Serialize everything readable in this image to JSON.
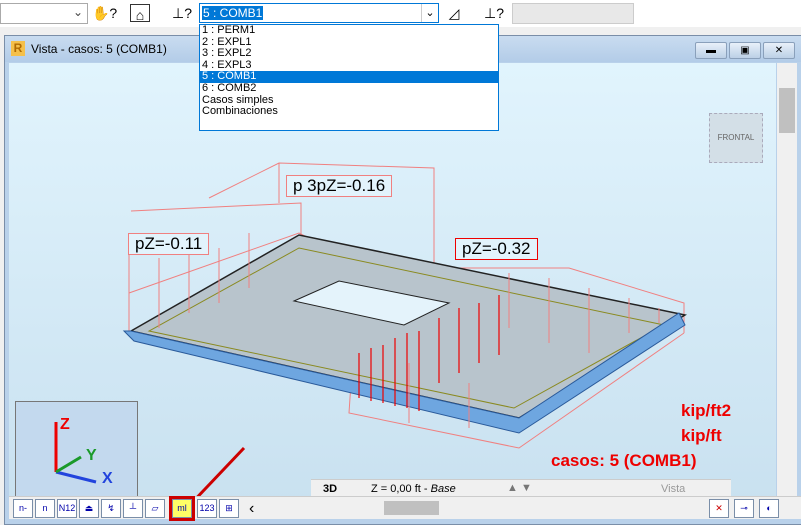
{
  "toolbar": {
    "selected_case": "5 : COMB1",
    "icons": [
      "hand-help-icon",
      "view-icon",
      "load-help-icon",
      "load-chart-icon",
      "load-help2-icon"
    ]
  },
  "case_list": [
    "1 : PERM1",
    "2 : EXPL1",
    "3 : EXPL2",
    "4 : EXPL3",
    "5 : COMB1",
    "6 : COMB2",
    "Casos simples",
    "Combinaciones"
  ],
  "window": {
    "title": "Vista - casos: 5 (COMB1)",
    "logo": "R",
    "view_cube": "FRONTAL"
  },
  "view": {
    "labels": [
      "p 3pZ=-0.16",
      "pZ=-0.11",
      "pZ=-0.32"
    ],
    "axes": {
      "z": "Z",
      "y": "Y",
      "x": "X"
    },
    "legend": {
      "area_unit": "kip/ft2",
      "line_unit": "kip/ft",
      "cases": "casos: 5 (COMB1)"
    }
  },
  "bottom": {
    "tab": "3D",
    "level": "Z = 0,00 ft - ",
    "level_name": "Base",
    "vista": "Vista"
  },
  "tools": [
    "n-",
    "n",
    "N12",
    "⏏",
    "↯",
    "┴",
    "▱",
    "ml",
    "123",
    "⊞"
  ]
}
